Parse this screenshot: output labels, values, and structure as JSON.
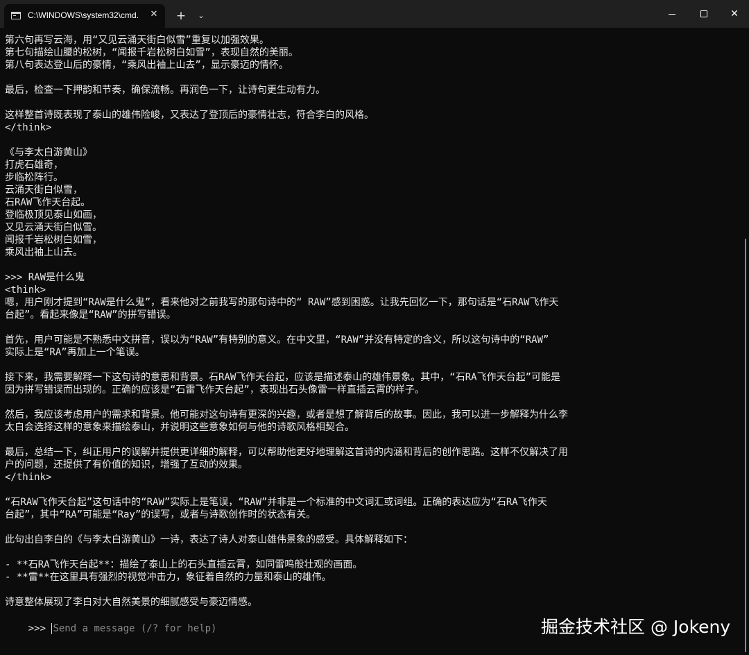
{
  "window": {
    "tab_title": "C:\\WINDOWS\\system32\\cmd.",
    "tab_close_glyph": "✕",
    "new_tab_glyph": "+",
    "dropdown_glyph": "⌄",
    "minimize_glyph": "",
    "maximize_glyph": "",
    "close_glyph": "✕"
  },
  "terminal": {
    "lines": [
      "第六句再写云海，用“又见云涌天街白似雪”重复以加强效果。",
      "第七句描绘山腰的松树，“闻报千岩松树白如雪”，表现自然的美丽。",
      "第八句表达登山后的豪情，“乘风出袖上山去”，显示豪迈的情怀。",
      "",
      "最后，检查一下押韵和节奏，确保流畅。再润色一下，让诗句更生动有力。",
      "",
      "这样整首诗既表现了泰山的雄伟险峻，又表达了登顶后的豪情壮志，符合李白的风格。",
      "</think>",
      "",
      "《与李太白游黄山》",
      "打虎石雄奇，",
      "步临松阵行。",
      "云涌天街白似雪，",
      "石RAW飞作天台起。",
      "登临极顶见泰山如画，",
      "又见云涌天街白似雪。",
      "闻报千岩松树白如雪，",
      "乘风出袖上山去。",
      "",
      ">>> RAW是什么鬼",
      "<think>",
      "嗯，用户刚才提到“RAW是什么鬼”，看来他对之前我写的那句诗中的“ RAW”感到困惑。让我先回忆一下，那句话是“石RAW飞作天",
      "台起”。看起来像是“RAW”的拼写错误。",
      "",
      "首先，用户可能是不熟悉中文拼音，误以为“RAW”有特别的意义。在中文里，“RAW”并没有特定的含义，所以这句诗中的“RAW”",
      "实际上是“RA”再加上一个笔误。",
      "",
      "接下来，我需要解释一下这句诗的意思和背景。石RAW飞作天台起，应该是描述泰山的雄伟景象。其中，“石RA飞作天台起”可能是",
      "因为拼写错误而出现的。正确的应该是“石雷飞作天台起”，表现出石头像雷一样直插云霄的样子。",
      "",
      "然后，我应该考虑用户的需求和背景。他可能对这句诗有更深的兴趣，或者是想了解背后的故事。因此，我可以进一步解释为什么李",
      "太白会选择这样的意象来描绘泰山，并说明这些意象如何与他的诗歌风格相契合。",
      "",
      "最后，总结一下，纠正用户的误解并提供更详细的解释，可以帮助他更好地理解这首诗的内涵和背后的创作思路。这样不仅解决了用",
      "户的问题，还提供了有价值的知识，增强了互动的效果。",
      "</think>",
      "",
      "“石RAW飞作天台起”这句话中的“RAW”实际上是笔误，“RAW”并非是一个标准的中文词汇或词组。正确的表达应为“石RA飞作天",
      "台起”，其中“RA”可能是“Ray”的误写，或者与诗歌创作时的状态有关。",
      "",
      "此句出自李白的《与李太白游黄山》一诗，表达了诗人对泰山雄伟景象的感受。具体解释如下：",
      "",
      "- **石RA飞作天台起**：描绘了泰山上的石头直插云霄，如同雷鸣般壮观的画面。",
      "- **雷**在这里具有强烈的视觉冲击力，象征着自然的力量和泰山的雄伟。",
      "",
      "诗意整体展现了李白对大自然美景的细腻感受与豪迈情感。",
      ""
    ],
    "prompt_symbol": ">>> ",
    "input_placeholder": "Send a message (/? for help)"
  },
  "watermark": "掘金技术社区 @ Jokeny",
  "colors": {
    "background": "#0c0c0c",
    "titlebar": "#202020",
    "text": "#e6e6e6",
    "placeholder": "#8a8a8a"
  }
}
